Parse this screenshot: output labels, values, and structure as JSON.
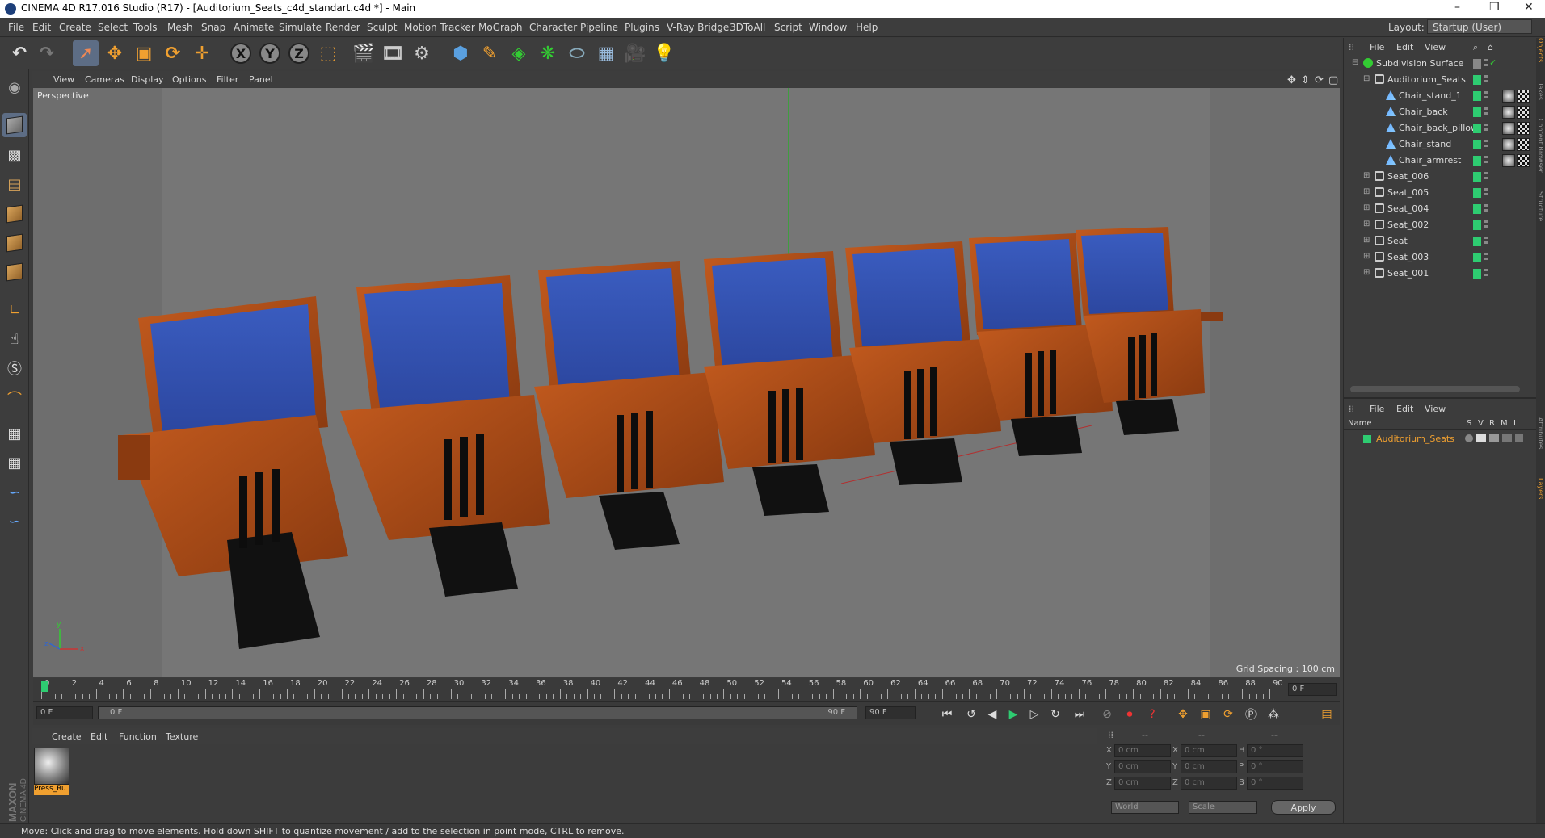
{
  "window": {
    "title": "CINEMA 4D R17.016 Studio (R17) - [Auditorium_Seats_c4d_standart.c4d *] - Main"
  },
  "menubar": {
    "items": [
      "File",
      "Edit",
      "Create",
      "Select",
      "Tools",
      "Mesh",
      "Snap",
      "Animate",
      "Simulate",
      "Render",
      "Sculpt",
      "Motion Tracker",
      "MoGraph",
      "Character",
      "Pipeline",
      "Plugins",
      "V-Ray Bridge",
      "3DToAll",
      "Script",
      "Window",
      "Help"
    ],
    "layout_label": "Layout:",
    "layout_value": "Startup (User)"
  },
  "viewport": {
    "menu": [
      "View",
      "Cameras",
      "Display",
      "Options",
      "Filter",
      "Panel"
    ],
    "label": "Perspective",
    "grid_spacing": "Grid Spacing : 100 cm",
    "axis": {
      "y": "y",
      "x": "x",
      "z": "z"
    }
  },
  "timeline": {
    "ticks": [
      "0",
      "2",
      "4",
      "6",
      "8",
      "10",
      "12",
      "14",
      "16",
      "18",
      "20",
      "22",
      "24",
      "26",
      "28",
      "30",
      "32",
      "34",
      "36",
      "38",
      "40",
      "42",
      "44",
      "46",
      "48",
      "50",
      "52",
      "54",
      "56",
      "58",
      "60",
      "62",
      "64",
      "66",
      "68",
      "70",
      "72",
      "74",
      "76",
      "78",
      "80",
      "82",
      "84",
      "86",
      "88",
      "90"
    ],
    "current_frame": "0 F",
    "start": "0 F",
    "range_start": "0 F",
    "range_end": "90 F",
    "end": "90 F"
  },
  "material": {
    "menu": [
      "Create",
      "Edit",
      "Function",
      "Texture"
    ],
    "item_label": "Press_Ru"
  },
  "coordinates": {
    "rows": [
      {
        "a": "X",
        "av": "0 cm",
        "b": "X",
        "bv": "0 cm",
        "c": "H",
        "cv": "0 °"
      },
      {
        "a": "Y",
        "av": "0 cm",
        "b": "Y",
        "bv": "0 cm",
        "c": "P",
        "cv": "0 °"
      },
      {
        "a": "Z",
        "av": "0 cm",
        "b": "Z",
        "bv": "0 cm",
        "c": "B",
        "cv": "0 °"
      }
    ],
    "mode1": "World",
    "mode2": "Scale",
    "apply": "Apply",
    "dashes": [
      "--",
      "--",
      "--"
    ]
  },
  "object_manager": {
    "menu": [
      "File",
      "Edit",
      "View"
    ],
    "items": [
      {
        "name": "Subdivision Surface",
        "indent": 0,
        "type": "subdiv"
      },
      {
        "name": "Auditorium_Seats",
        "indent": 1,
        "type": "null"
      },
      {
        "name": "Chair_stand_1",
        "indent": 2,
        "type": "poly"
      },
      {
        "name": "Chair_back",
        "indent": 2,
        "type": "poly"
      },
      {
        "name": "Chair_back_pillow",
        "indent": 2,
        "type": "poly"
      },
      {
        "name": "Chair_stand",
        "indent": 2,
        "type": "poly"
      },
      {
        "name": "Chair_armrest",
        "indent": 2,
        "type": "poly"
      },
      {
        "name": "Seat_006",
        "indent": 1,
        "type": "null"
      },
      {
        "name": "Seat_005",
        "indent": 1,
        "type": "null"
      },
      {
        "name": "Seat_004",
        "indent": 1,
        "type": "null"
      },
      {
        "name": "Seat_002",
        "indent": 1,
        "type": "null"
      },
      {
        "name": "Seat",
        "indent": 1,
        "type": "null"
      },
      {
        "name": "Seat_003",
        "indent": 1,
        "type": "null"
      },
      {
        "name": "Seat_001",
        "indent": 1,
        "type": "null"
      }
    ]
  },
  "layer_manager": {
    "menu": [
      "File",
      "Edit",
      "View"
    ],
    "columns": [
      "Name",
      "S",
      "V",
      "R",
      "M",
      "L"
    ],
    "items": [
      {
        "name": "Auditorium_Seats",
        "color": "#2ecc71"
      }
    ]
  },
  "side_tabs": [
    "Objects",
    "Takes",
    "Content Browser",
    "Structure",
    "Attributes",
    "Layers"
  ],
  "status": "Move: Click and drag to move elements. Hold down SHIFT to quantize movement / add to the selection in point mode, CTRL to remove.",
  "colors": {
    "accent": "#5d6d85",
    "green": "#2ecc71",
    "layer_text": "#f0a030"
  }
}
